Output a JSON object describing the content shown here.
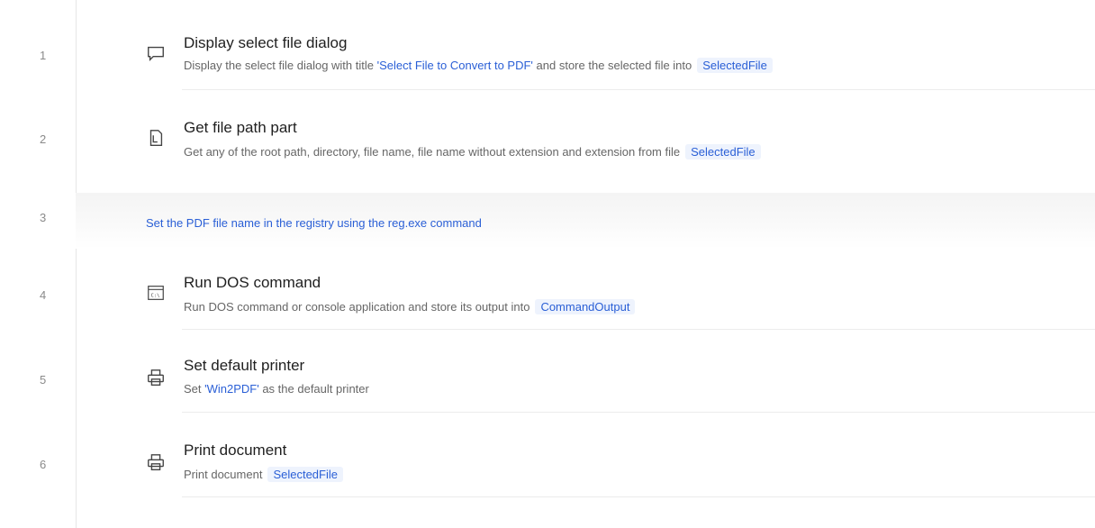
{
  "line_numbers": [
    "1",
    "2",
    "3",
    "4",
    "5",
    "6"
  ],
  "steps": [
    {
      "icon": "message-box-icon",
      "title": "Display select file dialog",
      "desc_prefix": "Display the select file dialog with title ",
      "desc_string": "'Select File to Convert to PDF'",
      "desc_mid": " and store the selected file into",
      "variable": "SelectedFile"
    },
    {
      "icon": "file-path-icon",
      "title": "Get file path part",
      "desc_prefix": "Get any of the root path, directory, file name, file name without extension and extension from file",
      "variable": "SelectedFile"
    },
    {
      "icon": "console-icon",
      "title": "Run DOS command",
      "desc_prefix": "Run DOS command or console application and store its output into",
      "variable": "CommandOutput"
    },
    {
      "icon": "printer-icon",
      "title": "Set default printer",
      "desc_prefix": "Set ",
      "desc_string": "'Win2PDF'",
      "desc_mid": " as the default printer"
    },
    {
      "icon": "printer-icon",
      "title": "Print document",
      "desc_prefix": "Print document",
      "variable": "SelectedFile"
    }
  ],
  "comment": "Set the PDF file name in the registry using the reg.exe command"
}
